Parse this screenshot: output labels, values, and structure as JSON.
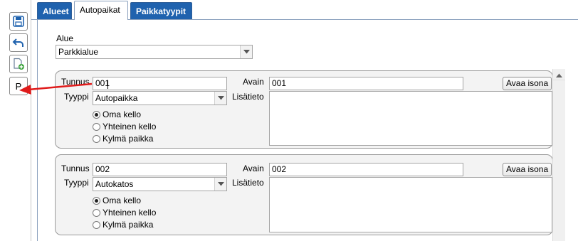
{
  "toolbar": {
    "p_label": "P"
  },
  "tabs": [
    {
      "label": "Alueet",
      "active": false
    },
    {
      "label": "Autopaikat",
      "active": true
    },
    {
      "label": "Paikkatyypit",
      "active": false
    }
  ],
  "area": {
    "label": "Alue",
    "value": "Parkkialue"
  },
  "cards": [
    {
      "tunnus_label": "Tunnus",
      "tunnus_value": "001",
      "tyyppi_label": "Tyyppi",
      "tyyppi_value": "Autopaikka",
      "avain_label": "Avain",
      "avain_value": "001",
      "lisatieto_label": "Lisätieto",
      "lisatieto_value": "",
      "open_large_label": "Avaa isona",
      "radios": [
        {
          "label": "Oma kello",
          "checked": true
        },
        {
          "label": "Yhteinen kello",
          "checked": false
        },
        {
          "label": "Kylmä paikka",
          "checked": false
        }
      ]
    },
    {
      "tunnus_label": "Tunnus",
      "tunnus_value": "002",
      "tyyppi_label": "Tyyppi",
      "tyyppi_value": "Autokatos",
      "avain_label": "Avain",
      "avain_value": "002",
      "lisatieto_label": "Lisätieto",
      "lisatieto_value": "",
      "open_large_label": "Avaa isona",
      "radios": [
        {
          "label": "Oma kello",
          "checked": true
        },
        {
          "label": "Yhteinen kello",
          "checked": false
        },
        {
          "label": "Kylmä paikka",
          "checked": false
        }
      ]
    }
  ],
  "colors": {
    "tab_active_bg": "#ffffff",
    "tab_inactive_bg": "#1f62ae",
    "card_bg": "#f3f3f3",
    "annotation_arrow": "#e01b1b"
  },
  "icons": [
    "save-icon",
    "undo-icon",
    "add-document-icon",
    "chevron-down-icon",
    "scroll-up-arrow-icon"
  ]
}
